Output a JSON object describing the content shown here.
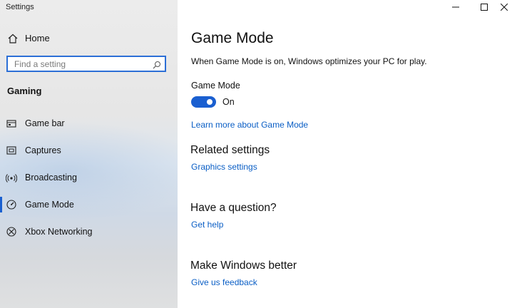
{
  "window": {
    "title": "Settings"
  },
  "sidebar": {
    "home_label": "Home",
    "search": {
      "placeholder": "Find a setting"
    },
    "section_title": "Gaming",
    "items": [
      {
        "label": "Game bar",
        "icon": "game-bar-icon"
      },
      {
        "label": "Captures",
        "icon": "captures-icon"
      },
      {
        "label": "Broadcasting",
        "icon": "broadcasting-icon"
      },
      {
        "label": "Game Mode",
        "icon": "game-mode-icon",
        "active": true
      },
      {
        "label": "Xbox Networking",
        "icon": "xbox-icon"
      }
    ]
  },
  "main": {
    "title": "Game Mode",
    "description": "When Game Mode is on, Windows optimizes your PC for play.",
    "toggle": {
      "label": "Game Mode",
      "state": "On",
      "on": true
    },
    "learn_more_link": "Learn more about Game Mode",
    "related": {
      "heading": "Related settings",
      "link": "Graphics settings"
    },
    "question": {
      "heading": "Have a question?",
      "link": "Get help"
    },
    "better": {
      "heading": "Make Windows better",
      "link": "Give us feedback"
    }
  },
  "colors": {
    "accent": "#1a5fd0",
    "link": "#0a5ec5",
    "search_border": "#2c6fd6"
  }
}
